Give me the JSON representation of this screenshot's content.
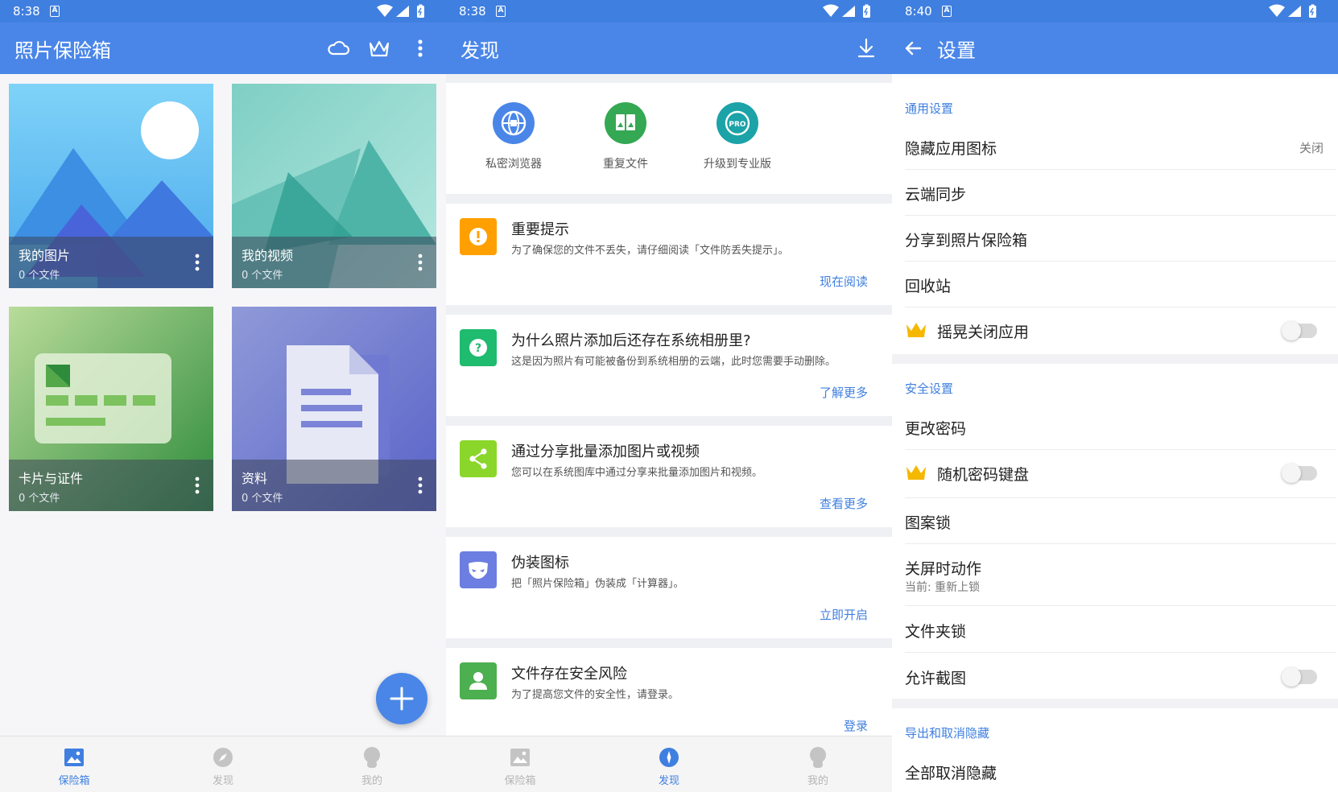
{
  "panels": [
    {
      "status_time": "8:38",
      "title": "照片保险箱",
      "icons": [
        "cloud-icon",
        "crown-icon",
        "more-vertical-icon"
      ],
      "albums": [
        {
          "name": "我的图片",
          "count": "0 个文件"
        },
        {
          "name": "我的视频",
          "count": "0 个文件"
        },
        {
          "name": "卡片与证件",
          "count": "0 个文件"
        },
        {
          "name": "资料",
          "count": "0 个文件"
        }
      ],
      "nav_active": 0
    },
    {
      "status_time": "8:38",
      "title": "发现",
      "icons": [
        "download-icon"
      ],
      "shortcuts": [
        {
          "label": "私密浏览器",
          "color": "#4a86e8"
        },
        {
          "label": "重复文件",
          "color": "#34a853"
        },
        {
          "label": "升级到专业版",
          "color": "#1ba3a8"
        }
      ],
      "cards": [
        {
          "title": "重要提示",
          "desc": "为了确保您的文件不丢失，请仔细阅读「文件防丢失提示」。",
          "action": "现在阅读",
          "color": "#ffa000"
        },
        {
          "title": "为什么照片添加后还存在系统相册里?",
          "desc": "这是因为照片有可能被备份到系统相册的云端，此时您需要手动删除。",
          "action": "了解更多",
          "color": "#1fbb6e"
        },
        {
          "title": "通过分享批量添加图片或视频",
          "desc": "您可以在系统图库中通过分享来批量添加图片和视频。",
          "action": "查看更多",
          "color": "#8bd62a"
        },
        {
          "title": "伪装图标",
          "desc": "把「照片保险箱」伪装成「计算器」。",
          "action": "立即开启",
          "color": "#6c7ee1"
        },
        {
          "title": "文件存在安全风险",
          "desc": "为了提高您文件的安全性，请登录。",
          "action": "登录",
          "color": "#4caf50"
        }
      ],
      "nav_active": 1
    },
    {
      "status_time": "8:40",
      "title": "设置",
      "general_section": "通用设置",
      "hide_icon": {
        "label": "隐藏应用图标",
        "value": "关闭"
      },
      "cloud_sync": "云端同步",
      "share_to": "分享到照片保险箱",
      "recycle": "回收站",
      "shake_close": {
        "label": "摇晃关闭应用",
        "on": false
      },
      "security_section": "安全设置",
      "change_password": "更改密码",
      "random_keyboard": {
        "label": "随机密码键盘",
        "on": false
      },
      "pattern_lock": "图案锁",
      "screen_off": {
        "label": "关屏时动作",
        "current": "当前: 重新上锁"
      },
      "folder_lock": "文件夹锁",
      "allow_screenshot": {
        "label": "允许截图",
        "on": false
      },
      "export_section": "导出和取消隐藏",
      "unhide_all": "全部取消隐藏"
    }
  ],
  "nav": [
    "保险箱",
    "发现",
    "我的"
  ],
  "colors": {
    "primary": "#4a86e8",
    "statusbar": "#3f7fe0",
    "crown": "#f5b800"
  }
}
